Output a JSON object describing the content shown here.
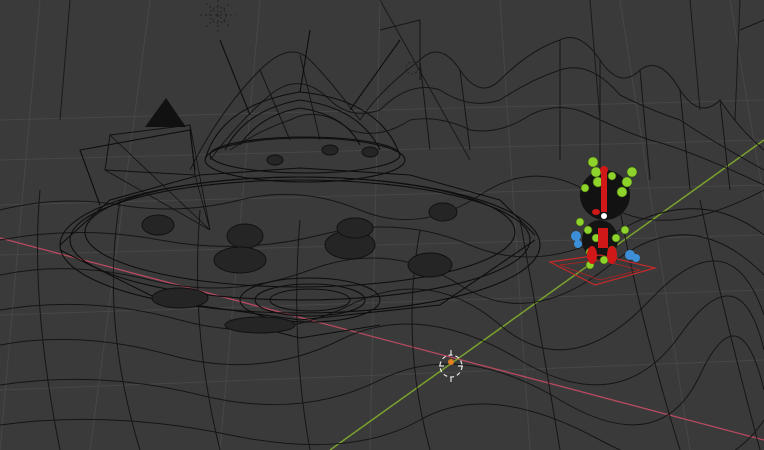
{
  "viewport": {
    "mode": "wireframe",
    "colors": {
      "background": "#3a3a3a",
      "grid_line": "#4a4a4a",
      "wire": "#101010",
      "x_axis": "#b84a5e",
      "y_axis": "#7aa12c",
      "bone_green": "#8ed22c",
      "bone_red": "#d01818",
      "bone_blue": "#3c8fd8",
      "cursor": "#e08020"
    },
    "objects": [
      {
        "name": "saucer-ship",
        "icon": "wireframe-mesh"
      },
      {
        "name": "terrain",
        "icon": "wireframe-mesh"
      },
      {
        "name": "character-rig",
        "icon": "armature-bones"
      },
      {
        "name": "camera",
        "icon": "camera-icon"
      },
      {
        "name": "lights",
        "icon": "light-icon"
      },
      {
        "name": "3d-cursor",
        "icon": "crosshair-icon"
      }
    ]
  }
}
